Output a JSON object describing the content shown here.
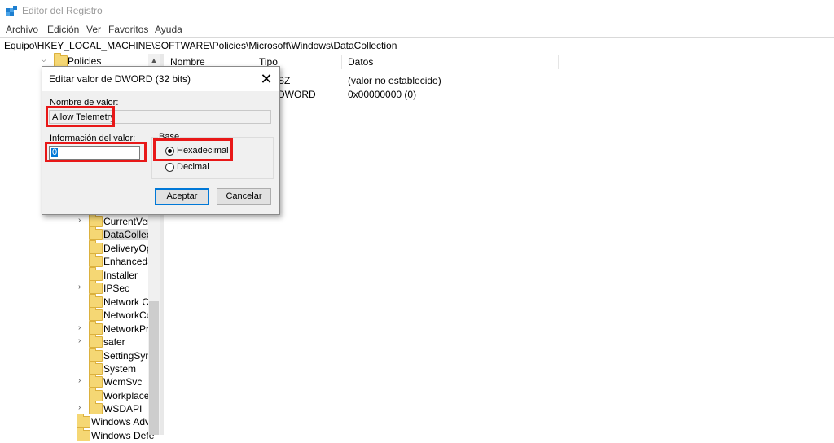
{
  "window": {
    "title": "Editor del Registro",
    "icon": "registry-editor-icon"
  },
  "menu": [
    "Archivo",
    "Edición",
    "Ver",
    "Favoritos",
    "Ayuda"
  ],
  "address": "Equipo\\HKEY_LOCAL_MACHINE\\SOFTWARE\\Policies\\Microsoft\\Windows\\DataCollection",
  "tree": {
    "top": {
      "label": "Policies"
    },
    "items": [
      {
        "label": "CurrentVers",
        "chevron": "›"
      },
      {
        "label": "DataCollect",
        "chevron": "",
        "selected": true
      },
      {
        "label": "DeliveryOpt",
        "chevron": ""
      },
      {
        "label": "EnhancedS",
        "chevron": ""
      },
      {
        "label": "Installer",
        "chevron": ""
      },
      {
        "label": "IPSec",
        "chevron": "›"
      },
      {
        "label": "Network Co",
        "chevron": ""
      },
      {
        "label": "NetworkCo",
        "chevron": ""
      },
      {
        "label": "NetworkPro",
        "chevron": "›"
      },
      {
        "label": "safer",
        "chevron": "›"
      },
      {
        "label": "SettingSync",
        "chevron": ""
      },
      {
        "label": "System",
        "chevron": ""
      },
      {
        "label": "WcmSvc",
        "chevron": "›"
      },
      {
        "label": "WorkplaceJ",
        "chevron": ""
      },
      {
        "label": "WSDAPI",
        "chevron": "›"
      }
    ],
    "bottom": [
      {
        "label": "Windows Adva"
      },
      {
        "label": "Windows Defe"
      }
    ]
  },
  "list": {
    "columns": {
      "name": "Nombre",
      "type": "Tipo",
      "data": "Datos"
    },
    "rows": [
      {
        "type": "SZ",
        "data": "(valor no establecido)"
      },
      {
        "type": "DWORD",
        "data": "0x00000000 (0)"
      }
    ]
  },
  "dialog": {
    "title": "Editar valor de DWORD (32 bits)",
    "close": "✕",
    "name_label": "Nombre de valor:",
    "name_value": "Allow Telemetry",
    "value_label": "Información del valor:",
    "value": "0",
    "base_label": "Base",
    "radios": {
      "hex": "Hexadecimal",
      "dec": "Decimal"
    },
    "ok": "Aceptar",
    "cancel": "Cancelar"
  },
  "colors": {
    "highlight": "#e81818",
    "accent": "#0078d7"
  }
}
